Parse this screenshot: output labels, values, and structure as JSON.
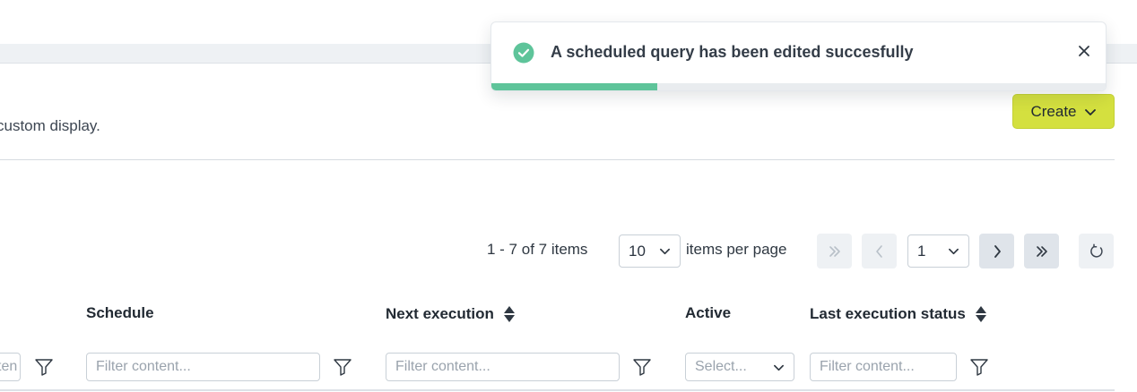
{
  "page": {
    "description": "custom display.",
    "create_label": "Create"
  },
  "pagination": {
    "range_text": "1 - 7 of 7 items",
    "per_page_value": "10",
    "per_page_label": "items per page",
    "current_page": "1"
  },
  "table": {
    "columns": [
      "Schedule",
      "Next execution",
      "Active",
      "Last execution status"
    ],
    "filters": {
      "first_cut": "ten",
      "schedule": "Filter content...",
      "next_execution": "Filter content...",
      "active": "Select...",
      "last_status": "Filter content..."
    }
  },
  "toast": {
    "message": "A scheduled query has been edited succesfully",
    "progress": 0.27,
    "success_color": "#5ec49a"
  },
  "colors": {
    "accent": "#d4e03f",
    "success": "#5ec49a"
  },
  "icons": [
    "chevron-down-icon",
    "double-chevron-left-icon",
    "chevron-left-icon",
    "chevron-right-icon",
    "double-chevron-right-icon",
    "refresh-icon",
    "sort-icon",
    "filter-icon",
    "check-circle-icon",
    "close-icon"
  ]
}
